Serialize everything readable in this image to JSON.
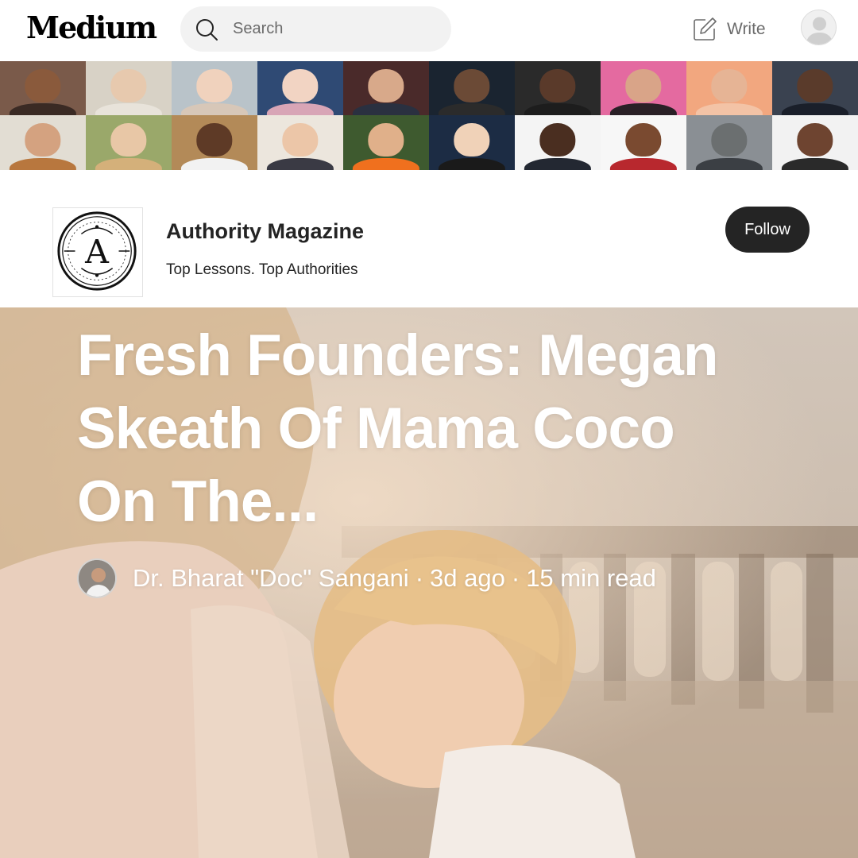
{
  "topbar": {
    "logo": "Medium",
    "search_placeholder": "Search",
    "write_label": "Write"
  },
  "icons": [
    "search-icon",
    "write-icon",
    "user-avatar-icon",
    "author-avatar"
  ],
  "collage": {
    "tiles": [
      {
        "bg": "#7a5a4a",
        "skin": "#8a5a3c",
        "cloth": "#3a2a24"
      },
      {
        "bg": "#d8d2c6",
        "skin": "#e7c9ae",
        "cloth": "#e8e3da"
      },
      {
        "bg": "#b9c3c9",
        "skin": "#f0d2bd",
        "cloth": "#d7c7b8"
      },
      {
        "bg": "#2f4a74",
        "skin": "#f2d4c3",
        "cloth": "#d8a5b6"
      },
      {
        "bg": "#4a2a2a",
        "skin": "#d8a98a",
        "cloth": "#2a3040"
      },
      {
        "bg": "#1a2430",
        "skin": "#6b4a36",
        "cloth": "#2b2b2b"
      },
      {
        "bg": "#2a2a2a",
        "skin": "#5a3a2a",
        "cloth": "#1d1d1d"
      },
      {
        "bg": "#e46aa0",
        "skin": "#d9a488",
        "cloth": "#2a2026"
      },
      {
        "bg": "#f2a77f",
        "skin": "#e6b495",
        "cloth": "#f3c3a6"
      },
      {
        "bg": "#3a4250",
        "skin": "#5a3b2b",
        "cloth": "#1a1f2a"
      },
      {
        "bg": "#e2ddd3",
        "skin": "#d4a280",
        "cloth": "#b8773e"
      },
      {
        "bg": "#9aa86a",
        "skin": "#e8c7a6",
        "cloth": "#d4b07a"
      },
      {
        "bg": "#b38a58",
        "skin": "#5e3a26",
        "cloth": "#f2f2f2"
      },
      {
        "bg": "#ece6dd",
        "skin": "#ecc6a8",
        "cloth": "#3a3a44"
      },
      {
        "bg": "#3e5a2f",
        "skin": "#e0b08a",
        "cloth": "#f0701e"
      },
      {
        "bg": "#1c2c44",
        "skin": "#f0d2b8",
        "cloth": "#1a1a1a"
      },
      {
        "bg": "#f4f4f4",
        "skin": "#4a2e20",
        "cloth": "#232832"
      },
      {
        "bg": "#f7f7f7",
        "skin": "#7a4a30",
        "cloth": "#b8282e"
      },
      {
        "bg": "#8a8f94",
        "skin": "#6b6f70",
        "cloth": "#3b3f44"
      },
      {
        "bg": "#f2f2f2",
        "skin": "#6e4430",
        "cloth": "#2a2a2a"
      }
    ]
  },
  "publication": {
    "name": "Authority Magazine",
    "tagline": "Top Lessons. Top Authorities",
    "logo_letter": "A",
    "follow_label": "Follow"
  },
  "article": {
    "title": "Fresh Founders: Megan Skeath Of Mama Coco On The...",
    "author": "Dr. Bharat \"Doc\" Sangani",
    "separator": "·",
    "age": "3d ago",
    "read_time": "15 min read"
  },
  "colors": {
    "brand_text": "#242424",
    "follow_bg": "#242424",
    "search_bg": "#f2f2f2",
    "muted": "#6b6b6b"
  }
}
